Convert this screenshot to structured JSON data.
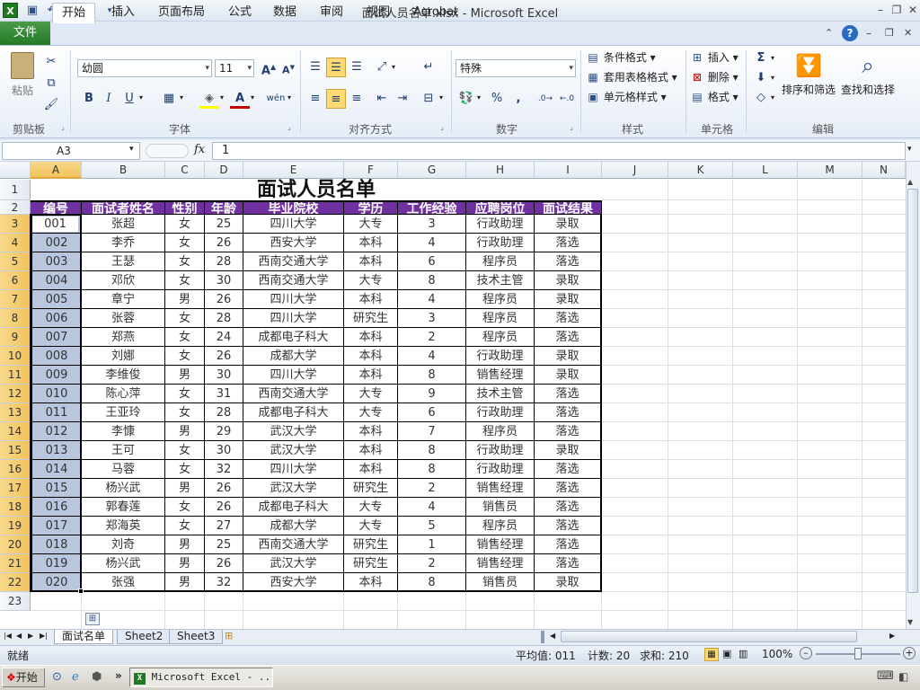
{
  "window": {
    "title": "面试人员名单.xlsx - Microsoft Excel",
    "minimize": "–",
    "restore": "❐",
    "close": "✕"
  },
  "ribbon_tabs": [
    "文件",
    "开始",
    "插入",
    "页面布局",
    "公式",
    "数据",
    "审阅",
    "视图",
    "Acrobat"
  ],
  "ribbon": {
    "clipboard": {
      "label": "剪贴板",
      "paste": "粘贴"
    },
    "font": {
      "label": "字体",
      "name": "幼圆",
      "size": "11"
    },
    "alignment": {
      "label": "对齐方式"
    },
    "number": {
      "label": "数字",
      "format": "特殊",
      "percent": "%",
      "comma": ","
    },
    "styles": {
      "label": "样式",
      "conditional": "条件格式",
      "table": "套用表格格式",
      "cell_styles": "单元格样式"
    },
    "cells": {
      "label": "单元格",
      "insert": "插入",
      "delete": "删除",
      "format": "格式"
    },
    "editing": {
      "label": "编辑",
      "sort": "排序和筛选",
      "find": "查找和选择"
    }
  },
  "formula_bar": {
    "name_box": "A3",
    "fx": "fx",
    "value": "1"
  },
  "columns": [
    "A",
    "B",
    "C",
    "D",
    "E",
    "F",
    "G",
    "H",
    "I",
    "J",
    "K",
    "L",
    "M",
    "N"
  ],
  "rows": [
    "1",
    "2",
    "3",
    "4",
    "5",
    "6",
    "7",
    "8",
    "9",
    "10",
    "11",
    "12",
    "13",
    "14",
    "15",
    "16",
    "17",
    "18",
    "19",
    "20",
    "21",
    "22",
    "23"
  ],
  "table": {
    "title": "面试人员名单",
    "headers": [
      "编号",
      "面试者姓名",
      "性别",
      "年龄",
      "毕业院校",
      "学历",
      "工作经验",
      "应聘岗位",
      "面试结果"
    ],
    "rows": [
      [
        "001",
        "张超",
        "女",
        "25",
        "四川大学",
        "大专",
        "3",
        "行政助理",
        "录取"
      ],
      [
        "002",
        "李乔",
        "女",
        "26",
        "西安大学",
        "本科",
        "4",
        "行政助理",
        "落选"
      ],
      [
        "003",
        "王瑟",
        "女",
        "28",
        "西南交通大学",
        "本科",
        "6",
        "程序员",
        "落选"
      ],
      [
        "004",
        "邓欣",
        "女",
        "30",
        "西南交通大学",
        "大专",
        "8",
        "技术主管",
        "录取"
      ],
      [
        "005",
        "章宁",
        "男",
        "26",
        "四川大学",
        "本科",
        "4",
        "程序员",
        "录取"
      ],
      [
        "006",
        "张蓉",
        "女",
        "28",
        "四川大学",
        "研究生",
        "3",
        "程序员",
        "落选"
      ],
      [
        "007",
        "郑燕",
        "女",
        "24",
        "成都电子科大",
        "本科",
        "2",
        "程序员",
        "落选"
      ],
      [
        "008",
        "刘娜",
        "女",
        "26",
        "成都大学",
        "本科",
        "4",
        "行政助理",
        "录取"
      ],
      [
        "009",
        "李维俊",
        "男",
        "30",
        "四川大学",
        "本科",
        "8",
        "销售经理",
        "录取"
      ],
      [
        "010",
        "陈心萍",
        "女",
        "31",
        "西南交通大学",
        "大专",
        "9",
        "技术主管",
        "落选"
      ],
      [
        "011",
        "王亚玲",
        "女",
        "28",
        "成都电子科大",
        "大专",
        "6",
        "行政助理",
        "落选"
      ],
      [
        "012",
        "李慷",
        "男",
        "29",
        "武汉大学",
        "本科",
        "7",
        "程序员",
        "落选"
      ],
      [
        "013",
        "王可",
        "女",
        "30",
        "武汉大学",
        "本科",
        "8",
        "行政助理",
        "录取"
      ],
      [
        "014",
        "马蓉",
        "女",
        "32",
        "四川大学",
        "本科",
        "8",
        "行政助理",
        "落选"
      ],
      [
        "015",
        "杨兴武",
        "男",
        "26",
        "武汉大学",
        "研究生",
        "2",
        "销售经理",
        "落选"
      ],
      [
        "016",
        "郭春莲",
        "女",
        "26",
        "成都电子科大",
        "大专",
        "4",
        "销售员",
        "落选"
      ],
      [
        "017",
        "郑海英",
        "女",
        "27",
        "成都大学",
        "大专",
        "5",
        "程序员",
        "落选"
      ],
      [
        "018",
        "刘奇",
        "男",
        "25",
        "西南交通大学",
        "研究生",
        "1",
        "销售经理",
        "落选"
      ],
      [
        "019",
        "杨兴武",
        "男",
        "26",
        "武汉大学",
        "研究生",
        "2",
        "销售经理",
        "落选"
      ],
      [
        "020",
        "张强",
        "男",
        "32",
        "西安大学",
        "本科",
        "8",
        "销售员",
        "录取"
      ]
    ]
  },
  "sheet_tabs": [
    "面试名单",
    "Sheet2",
    "Sheet3"
  ],
  "status": {
    "ready": "就绪",
    "average": "平均值: 011",
    "count": "计数: 20",
    "sum": "求和: 210",
    "zoom": "100%"
  },
  "taskbar": {
    "start": "开始",
    "excel_task": "Microsoft Excel - ..."
  },
  "colors": {
    "header_purple": "#7030a0",
    "selection_blue": "#b8c7de",
    "file_tab_green": "#2e7d32"
  }
}
